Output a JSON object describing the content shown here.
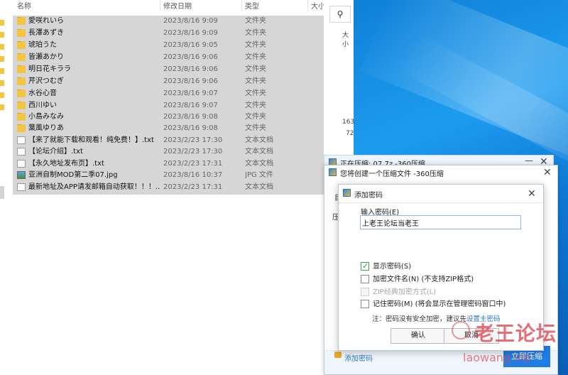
{
  "explorer": {
    "columns": {
      "name": "名称",
      "date": "修改日期",
      "type": "类型",
      "size": "大小"
    },
    "files": [
      {
        "name": "愛咲れいら",
        "date": "2023/8/16 9:09",
        "type": "文件夹",
        "icon": "folder-icon"
      },
      {
        "name": "長澤あずき",
        "date": "2023/8/16 9:09",
        "type": "文件夹",
        "icon": "folder-icon"
      },
      {
        "name": "琥珀うた",
        "date": "2023/8/16 9:05",
        "type": "文件夹",
        "icon": "folder-icon"
      },
      {
        "name": "皆瀬あかり",
        "date": "2023/8/16 9:06",
        "type": "文件夹",
        "icon": "folder-icon"
      },
      {
        "name": "明日花キララ",
        "date": "2023/8/16 9:06",
        "type": "文件夹",
        "icon": "folder-icon"
      },
      {
        "name": "芹沢つむぎ",
        "date": "2023/8/16 9:06",
        "type": "文件夹",
        "icon": "folder-icon"
      },
      {
        "name": "水谷心音",
        "date": "2023/8/16 9:07",
        "type": "文件夹",
        "icon": "folder-icon"
      },
      {
        "name": "西川ゆい",
        "date": "2023/8/16 9:07",
        "type": "文件夹",
        "icon": "folder-icon"
      },
      {
        "name": "小島みなみ",
        "date": "2023/8/16 9:08",
        "type": "文件夹",
        "icon": "folder-icon"
      },
      {
        "name": "葉風ゆりあ",
        "date": "2023/8/16 9:08",
        "type": "文件夹",
        "icon": "folder-icon"
      },
      {
        "name": "【来了就能下载和观看！纯免费！】.txt",
        "date": "2023/2/23 17:30",
        "type": "文本文档",
        "icon": "text-file-icon"
      },
      {
        "name": "【论坛介绍】.txt",
        "date": "2023/2/23 17:30",
        "type": "文本文档",
        "icon": "text-file-icon"
      },
      {
        "name": "【永久地址发布页】.txt",
        "date": "2023/2/23 17:31",
        "type": "文本文档",
        "icon": "text-file-icon"
      },
      {
        "name": "亚洲自制MOD第二季07.jpg",
        "date": "2023/8/16 10:37",
        "type": "JPG 文件",
        "icon": "image-file-icon"
      },
      {
        "name": "最新地址及APP请发邮箱自动获取！！！...",
        "date": "2023/2/23 17:31",
        "type": "文本文档",
        "icon": "text-file-icon"
      }
    ],
    "side": {
      "size_header": "大小",
      "num1": "163",
      "num2": "72"
    }
  },
  "dialog_back": {
    "title": "正在压缩: 07.7z -360压缩"
  },
  "dialog_main": {
    "title": "您将创建一个压缩文件 -360压缩",
    "side_label_1": "目",
    "side_label_2": "压",
    "add_password_link": "添加密码",
    "start_button": "立即压缩"
  },
  "password_dialog": {
    "title": "添加密码",
    "input_label": "输入密码(E)",
    "password_value": "上老王论坛当老王",
    "options": [
      {
        "label": "显示密码(S)",
        "checked": true,
        "disabled": false
      },
      {
        "label": "加密文件名(N) (不支持ZIP格式)",
        "checked": false,
        "disabled": false
      },
      {
        "label": "ZIP经典加密方式(L)",
        "checked": false,
        "disabled": true
      },
      {
        "label": "记住密码(M) (将会显示在管理密码窗口中)",
        "checked": false,
        "disabled": false
      }
    ],
    "note_text": "注：密码没有安全加密，建议先",
    "note_link": "设置主密码",
    "ok_button": "确认",
    "cancel_button": "取消"
  },
  "watermark": {
    "text": "老王论坛",
    "url": "laowang.vip"
  }
}
